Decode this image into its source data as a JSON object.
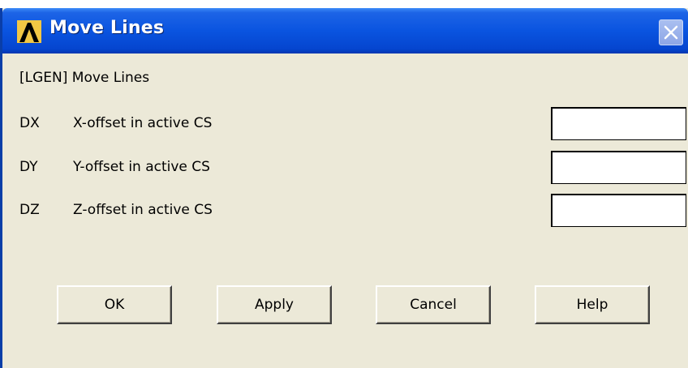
{
  "window": {
    "title": "Move Lines",
    "close_symbol": "×"
  },
  "dialog": {
    "command_label": "[LGEN]  Move Lines",
    "fields": [
      {
        "key": "DX",
        "description": "X-offset in active CS",
        "value": ""
      },
      {
        "key": "DY",
        "description": "Y-offset in active CS",
        "value": ""
      },
      {
        "key": "DZ",
        "description": "Z-offset in active CS",
        "value": ""
      }
    ]
  },
  "buttons": {
    "ok": "OK",
    "apply": "Apply",
    "cancel": "Cancel",
    "help": "Help"
  },
  "colors": {
    "titlebar": "#0a54e0",
    "dialog_bg": "#ece9d8",
    "app_icon": "#f2c744"
  },
  "icons": {
    "app": "ansys-lambda-icon",
    "close": "close-icon"
  }
}
